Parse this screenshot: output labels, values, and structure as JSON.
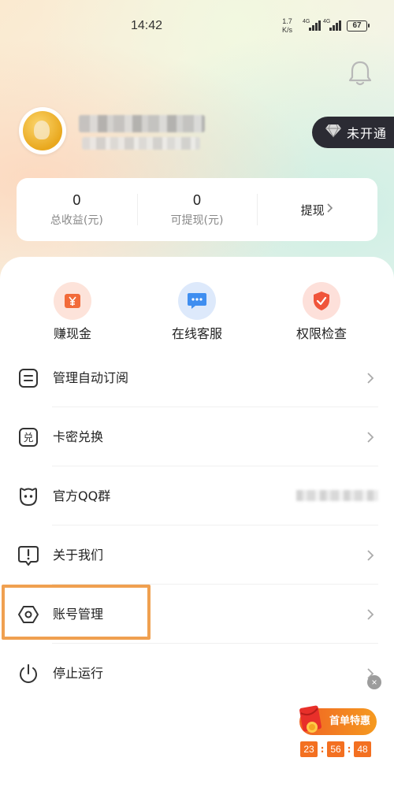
{
  "status_bar": {
    "time": "14:42",
    "net_speed_value": "1.7",
    "net_speed_unit": "K/s",
    "sim1_tag": "4G",
    "sim2_tag": "4G",
    "battery": "67"
  },
  "profile": {
    "vip_badge": "未开通"
  },
  "earnings": {
    "total_value": "0",
    "total_label": "总收益(元)",
    "withdrawable_value": "0",
    "withdrawable_label": "可提现(元)",
    "withdraw_label": "提现"
  },
  "quick_actions": [
    {
      "label": "赚现金",
      "icon": "yen-icon",
      "color": "#f26b3a"
    },
    {
      "label": "在线客服",
      "icon": "chat-bubble-icon",
      "color": "#3f8ef0"
    },
    {
      "label": "权限检查",
      "icon": "shield-check-icon",
      "color": "#f0543a"
    }
  ],
  "menu": [
    {
      "label": "管理自动订阅",
      "icon": "subscription-icon"
    },
    {
      "label": "卡密兑换",
      "icon": "redeem-icon"
    },
    {
      "label": "官方QQ群",
      "icon": "qq-icon"
    },
    {
      "label": "关于我们",
      "icon": "info-exclamation-icon"
    },
    {
      "label": "账号管理",
      "icon": "account-hexagon-icon"
    },
    {
      "label": "停止运行",
      "icon": "power-icon"
    }
  ],
  "promo": {
    "label": "首单特惠",
    "timer": [
      "23",
      "56",
      "48"
    ]
  }
}
